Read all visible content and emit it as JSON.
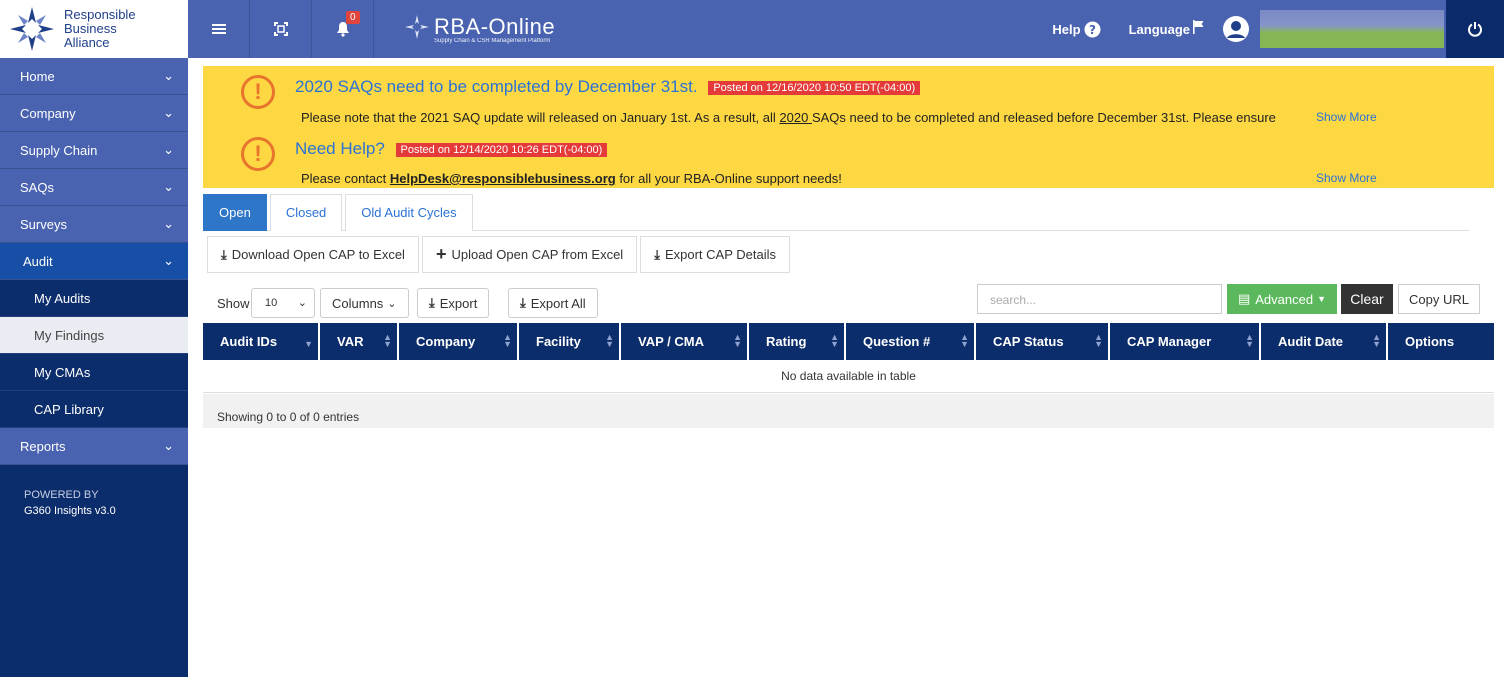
{
  "logo": {
    "line1": "Responsible",
    "line2": "Business",
    "line3": "Alliance"
  },
  "topbar": {
    "notification_count": "0",
    "brand_name": "RBA-Online",
    "brand_sub": "Supply Chain & CSR Management Platform",
    "help_label": "Help",
    "language_label": "Language"
  },
  "sidebar": {
    "items": [
      {
        "label": "Home"
      },
      {
        "label": "Company"
      },
      {
        "label": "Supply Chain"
      },
      {
        "label": "SAQs"
      },
      {
        "label": "Surveys"
      },
      {
        "label": "Audit"
      }
    ],
    "sub_items": [
      {
        "label": "My Audits"
      },
      {
        "label": "My Findings"
      },
      {
        "label": "My CMAs"
      },
      {
        "label": "CAP Library"
      }
    ],
    "reports_label": "Reports",
    "powered_by": "POWERED BY",
    "version": "G360 Insights v3.0"
  },
  "announcements": [
    {
      "title": "2020 SAQs need to be completed by December 31st.",
      "posted": "Posted on 12/16/2020 10:50 EDT(-04:00)",
      "body_a": "Please note that the 2021 SAQ update will released on January 1st. As a result, all ",
      "body_link": "2020 ",
      "body_b": "SAQs need to be completed and released before December 31st. Please ensure",
      "show_more": "Show More"
    },
    {
      "title": "Need Help?",
      "posted": "Posted on 12/14/2020 10:26 EDT(-04:00)",
      "body_a": "Please contact ",
      "body_link": "HelpDesk@responsiblebusiness.org",
      "body_b": " for all your RBA-Online support needs!",
      "show_more": "Show More"
    }
  ],
  "tabs": [
    {
      "label": "Open"
    },
    {
      "label": "Closed"
    },
    {
      "label": "Old Audit Cycles"
    }
  ],
  "cap_buttons": {
    "download": "Download Open CAP to Excel",
    "upload": "Upload Open CAP from Excel",
    "export_details": "Export CAP Details"
  },
  "table_tools": {
    "show_label": "Show",
    "page_size": "10",
    "columns": "Columns",
    "export": "Export",
    "export_all": "Export All",
    "search_placeholder": "search...",
    "advanced": "Advanced",
    "clear": "Clear",
    "copy_url": "Copy URL"
  },
  "table": {
    "headers": [
      "Audit IDs",
      "VAR",
      "Company",
      "Facility",
      "VAP / CMA",
      "Rating",
      "Question #",
      "CAP Status",
      "CAP Manager",
      "Audit Date",
      "Options"
    ],
    "empty": "No data available in table",
    "footer": "Showing 0 to 0 of 0 entries"
  },
  "colors": {
    "topbar": "#4a63b0",
    "sidebar": "#0c2d6b",
    "announce": "#fdd843",
    "accent": "#2e77c8"
  }
}
